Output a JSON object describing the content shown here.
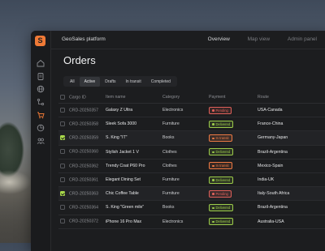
{
  "app": {
    "brand": "GeoSales platform",
    "logo_letter": "S",
    "nav": [
      {
        "label": "Overview",
        "active": true
      },
      {
        "label": "Map view",
        "active": false
      },
      {
        "label": "Admin panel",
        "active": false
      }
    ]
  },
  "sidebar": {
    "icons": [
      "home-icon",
      "clipboard-icon",
      "globe-icon",
      "route-icon",
      "cart-icon",
      "chart-icon",
      "users-icon"
    ]
  },
  "page": {
    "title": "Orders",
    "filters": [
      {
        "label": "All",
        "active": false
      },
      {
        "label": "Active",
        "active": true
      },
      {
        "label": "Drafts",
        "active": false
      },
      {
        "label": "In transit",
        "active": false
      },
      {
        "label": "Completed",
        "active": false
      }
    ]
  },
  "table": {
    "columns": [
      "Cargo ID",
      "Item name",
      "Category",
      "Payment",
      "Route"
    ],
    "rows": [
      {
        "id": "CRD-20250357",
        "item": "Galaxy Z Ultra",
        "category": "Electronics",
        "payment": "Pending",
        "route": "USA-Canada",
        "checked": false
      },
      {
        "id": "CRD-20250358",
        "item": "Sleek Sofa 3000",
        "category": "Furniture",
        "payment": "Delivered",
        "route": "France-China",
        "checked": false
      },
      {
        "id": "CRD-20250359",
        "item": "S. King \"IT\"",
        "category": "Books",
        "payment": "In transit",
        "route": "Germany-Japan",
        "checked": true
      },
      {
        "id": "CRD-20250360",
        "item": "Stylish Jacket 1 V",
        "category": "Clothes",
        "payment": "Delivered",
        "route": "Brazil-Argentina",
        "checked": false
      },
      {
        "id": "CRD-20250362",
        "item": "Trendy Coat P60 Pro",
        "category": "Clothes",
        "payment": "In transit",
        "route": "Mexico-Spain",
        "checked": false
      },
      {
        "id": "CRD-20250361",
        "item": "Elegant Dining Set",
        "category": "Furniture",
        "payment": "Delivered",
        "route": "India-UK",
        "checked": false
      },
      {
        "id": "CRD-20250363",
        "item": "Chic Coffee Table",
        "category": "Furniture",
        "payment": "Pending",
        "route": "Italy-South Africa",
        "checked": true
      },
      {
        "id": "CRD-20250364",
        "item": "S. King \"Green mile\"",
        "category": "Books",
        "payment": "Delivered",
        "route": "Brazil-Argentina",
        "checked": false
      },
      {
        "id": "CRD-20250372",
        "item": "iPhone 16 Pro Max",
        "category": "Electronics",
        "payment": "Delivered",
        "route": "Australia-USA",
        "checked": false
      }
    ]
  },
  "colors": {
    "accent": "#f07a36",
    "check": "#a8d84a",
    "pending": "#e0605a",
    "delivered": "#9ccc4a",
    "in_transit": "#ee7a44"
  }
}
